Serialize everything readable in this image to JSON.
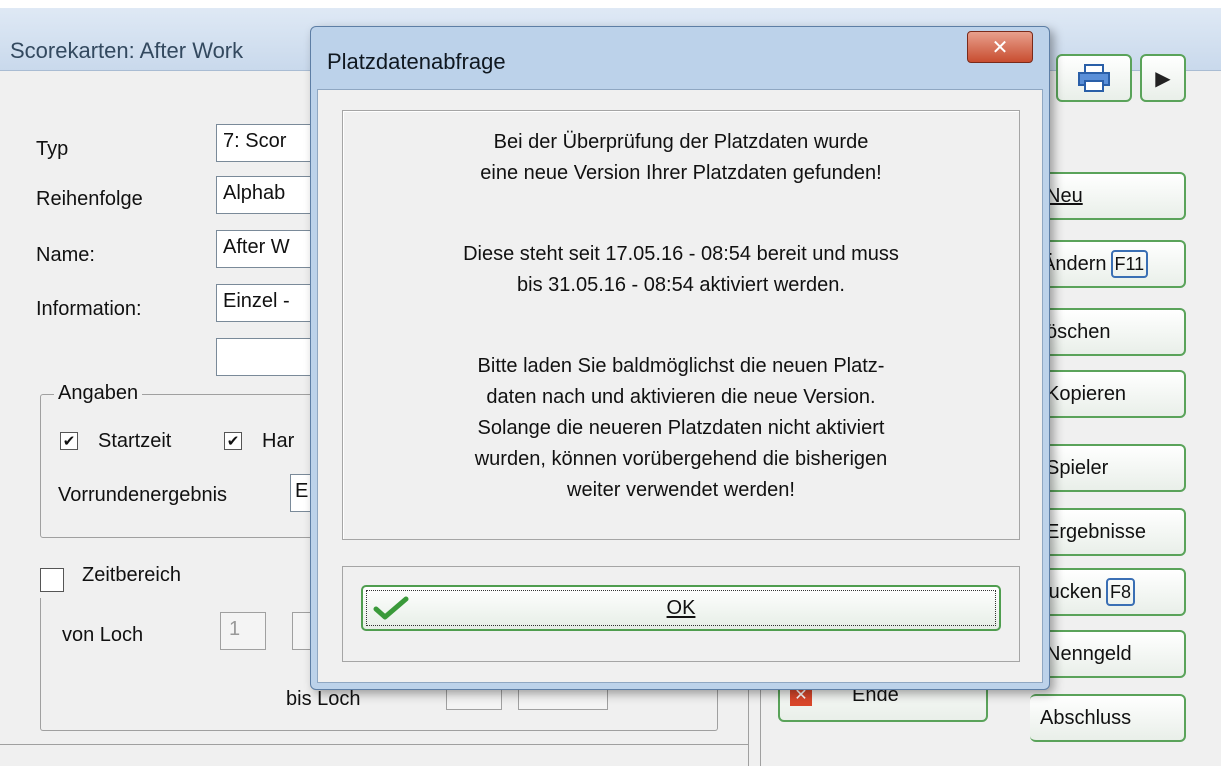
{
  "background": {
    "title": "Scorekarten: After Work",
    "labels": {
      "typ": "Typ",
      "reihenfolge": "Reihenfolge",
      "name": "Name:",
      "information": "Information:"
    },
    "fields": {
      "typ": "7: Scor",
      "reihenfolge": "Alphab",
      "name": "After W",
      "information": "Einzel -",
      "extra": ""
    },
    "angaben": {
      "legend": "Angaben",
      "startzeit_label": "Startzeit",
      "startzeit_checked": true,
      "handicap_label": "Har",
      "handicap_checked": true,
      "vorrunde_label": "Vorrundenergebnis",
      "vorrunde_value": "E"
    },
    "zeitbereich": {
      "label": "Zeitbereich",
      "checked": false,
      "von_loch_label": "von Loch",
      "von_loch_value": "1",
      "bis_loch_label": "bis Loch"
    },
    "buttons": {
      "neu": "Neu",
      "aendern": "Ändern",
      "aendern_key": "F11",
      "loeschen": "öschen",
      "kopieren": "Kopieren",
      "spieler": "Spieler",
      "ergebnisse": "Ergebnisse",
      "drucken": "rucken",
      "drucken_key": "F8",
      "nenngeld": "Nenngeld",
      "abschluss": "Abschluss",
      "ende": "Ende"
    }
  },
  "dialog": {
    "title": "Platzdatenabfrage",
    "close_symbol": "✕",
    "message": {
      "p1_line1": "Bei der Überprüfung der Platzdaten wurde",
      "p1_line2": "eine neue Version Ihrer Platzdaten gefunden!",
      "p2_line1": "Diese steht seit 17.05.16 - 08:54 bereit und muss",
      "p2_line2": "bis 31.05.16 - 08:54 aktiviert werden.",
      "p3_line1": "Bitte laden Sie baldmöglichst die neuen Platz-",
      "p3_line2": "daten nach und aktivieren die neue Version.",
      "p3_line3": "Solange die neueren Platzdaten nicht aktiviert",
      "p3_line4": "wurden, können vorübergehend die bisherigen",
      "p3_line5": "weiter verwendet werden!"
    },
    "ok_label": "OK"
  },
  "colors": {
    "accent_green": "#4f9d4f",
    "titlebar_blue": "#bcd2ea",
    "close_red": "#c84d30"
  }
}
